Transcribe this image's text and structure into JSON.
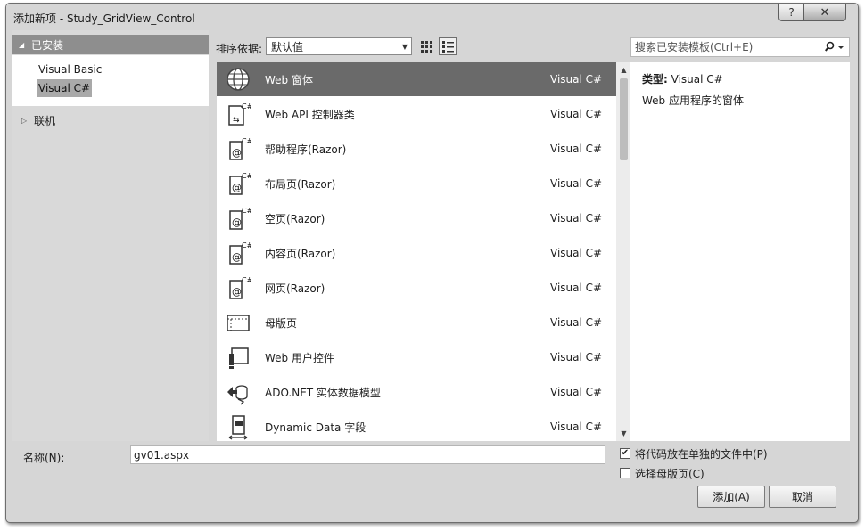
{
  "window": {
    "title": "添加新项 - Study_GridView_Control",
    "help_label": "?",
    "close_label": "✕"
  },
  "tree": {
    "installed": "已安装",
    "sub_items": [
      {
        "label": "Visual Basic",
        "selected": false
      },
      {
        "label": "Visual C#",
        "selected": true
      }
    ],
    "online": "联机"
  },
  "sort": {
    "label": "排序依据:",
    "value": "默认值"
  },
  "search": {
    "placeholder": "搜索已安装模板(Ctrl+E)"
  },
  "templates": [
    {
      "name": "Web 窗体",
      "language": "Visual C#",
      "icon": "web-form-icon",
      "selected": true
    },
    {
      "name": "Web API 控制器类",
      "language": "Visual C#",
      "icon": "webapi-controller-icon",
      "selected": false
    },
    {
      "name": "帮助程序(Razor)",
      "language": "Visual C#",
      "icon": "razor-icon",
      "selected": false
    },
    {
      "name": "布局页(Razor)",
      "language": "Visual C#",
      "icon": "razor-icon",
      "selected": false
    },
    {
      "name": "空页(Razor)",
      "language": "Visual C#",
      "icon": "razor-icon",
      "selected": false
    },
    {
      "name": "内容页(Razor)",
      "language": "Visual C#",
      "icon": "razor-icon",
      "selected": false
    },
    {
      "name": "网页(Razor)",
      "language": "Visual C#",
      "icon": "razor-icon",
      "selected": false
    },
    {
      "name": "母版页",
      "language": "Visual C#",
      "icon": "master-page-icon",
      "selected": false
    },
    {
      "name": "Web 用户控件",
      "language": "Visual C#",
      "icon": "user-control-icon",
      "selected": false
    },
    {
      "name": "ADO.NET 实体数据模型",
      "language": "Visual C#",
      "icon": "entity-model-icon",
      "selected": false
    },
    {
      "name": "Dynamic Data 字段",
      "language": "Visual C#",
      "icon": "dynamic-data-icon",
      "selected": false
    }
  ],
  "details": {
    "type_label": "类型:",
    "type_value": "Visual C#",
    "description": "Web 应用程序的窗体"
  },
  "name_field": {
    "label": "名称(N):",
    "value": "gv01.aspx"
  },
  "options": [
    {
      "label": "将代码放在单独的文件中(P)",
      "checked": true
    },
    {
      "label": "选择母版页(C)",
      "checked": false
    }
  ],
  "buttons": {
    "add": "添加(A)",
    "cancel": "取消"
  }
}
